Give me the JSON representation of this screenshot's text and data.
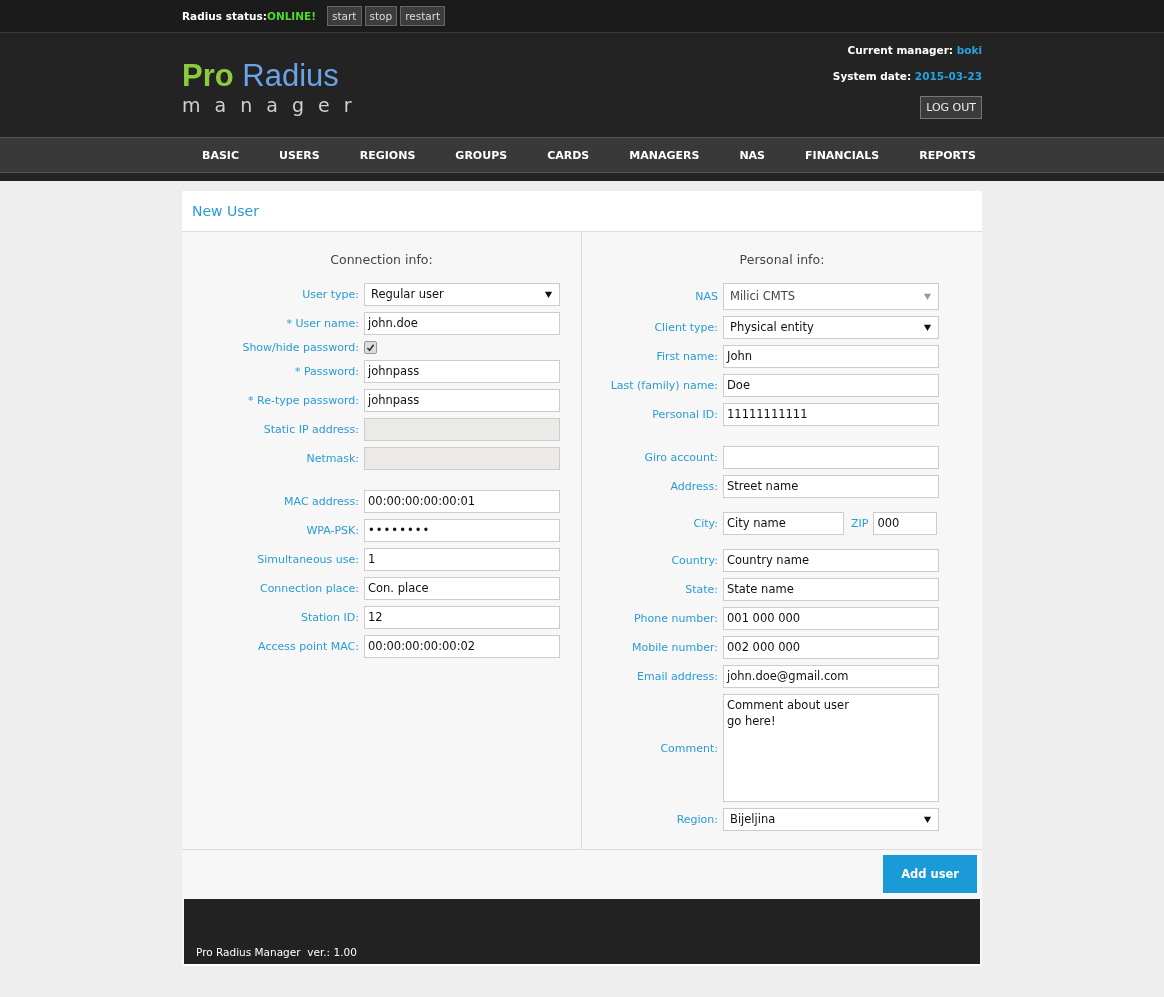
{
  "status_bar": {
    "label": "Radius status:",
    "status": "ONLINE!",
    "online": true,
    "buttons": [
      "start",
      "stop",
      "restart"
    ]
  },
  "header": {
    "logo": {
      "word1": "Pro",
      "word2": "Radius",
      "subtitle": "m a n a g e r"
    },
    "manager_label": "Current manager:",
    "manager": "boki",
    "date_label": "System date:",
    "date": "2015-03-23",
    "logout": "LOG OUT"
  },
  "nav": [
    {
      "label": "BASIC",
      "selected": false
    },
    {
      "label": "USERS",
      "selected": false
    },
    {
      "label": "REGIONS",
      "selected": false
    },
    {
      "label": "GROUPS",
      "selected": false
    },
    {
      "label": "CARDS",
      "selected": false
    },
    {
      "label": "MANAGERS",
      "selected": false
    },
    {
      "label": "NAS",
      "selected": false
    },
    {
      "label": "FINANCIALS",
      "selected": false
    },
    {
      "label": "REPORTS",
      "selected": false
    }
  ],
  "panel": {
    "title": "New User",
    "connection": {
      "heading": "Connection info:",
      "groups": [
        [
          {
            "kind": "select",
            "label": "User type:",
            "value": "Regular user"
          },
          {
            "kind": "text",
            "label": "* User name:",
            "value": "john.doe"
          },
          {
            "kind": "checkbox",
            "label": "Show/hide password:",
            "checked": true
          },
          {
            "kind": "text",
            "label": "* Password:",
            "value": "johnpass"
          },
          {
            "kind": "text",
            "label": "* Re-type password:",
            "value": "johnpass"
          },
          {
            "kind": "disabled",
            "label": "Static IP address:"
          },
          {
            "kind": "disabled",
            "label": "Netmask:"
          }
        ],
        [
          {
            "kind": "text",
            "label": "MAC address:",
            "value": "00:00:00:00:00:01"
          },
          {
            "kind": "password",
            "label": "WPA-PSK:",
            "value": "••••••••"
          },
          {
            "kind": "text",
            "label": "Simultaneous use:",
            "value": "1"
          },
          {
            "kind": "text",
            "label": "Connection place:",
            "value": "Con. place"
          },
          {
            "kind": "text",
            "label": "Station ID:",
            "value": "12"
          },
          {
            "kind": "text",
            "label": "Access point MAC:",
            "value": "00:00:00:00:00:02"
          }
        ]
      ]
    },
    "personal": {
      "heading": "Personal info:",
      "groups": [
        [
          {
            "kind": "combo",
            "label": "NAS",
            "value": "Milici CMTS"
          },
          {
            "kind": "select",
            "label": "Client type:",
            "value": "Physical entity"
          },
          {
            "kind": "text",
            "label": "First name:",
            "value": "John"
          },
          {
            "kind": "text",
            "label": "Last (family) name:",
            "value": "Doe"
          },
          {
            "kind": "text",
            "label": "Personal ID:",
            "value": "11111111111"
          }
        ],
        [
          {
            "kind": "text",
            "label": "Giro account:"
          },
          {
            "kind": "text",
            "label": "Address:",
            "value": "Street name"
          },
          {
            "kind": "city-zip",
            "label": "City:",
            "value": "City name",
            "zip_label": "ZIP",
            "zip_value": "000"
          },
          {
            "kind": "text",
            "label": "Country:",
            "value": "Country name"
          },
          {
            "kind": "text",
            "label": "State:",
            "value": "State name"
          },
          {
            "kind": "text",
            "label": "Phone number:",
            "value": "001 000 000"
          },
          {
            "kind": "text",
            "label": "Mobile number:",
            "value": "002 000 000"
          },
          {
            "kind": "text",
            "label": "Email address:",
            "value": "john.doe@gmail.com"
          },
          {
            "kind": "textarea",
            "label": "Comment:",
            "value": "Comment about user\ngo here!"
          },
          {
            "kind": "select",
            "label": "Region:",
            "value": "Bijeljina"
          }
        ]
      ]
    },
    "submit": "Add user"
  },
  "footer": {
    "text": "Pro Radius Manager  ver.: 1.00"
  }
}
